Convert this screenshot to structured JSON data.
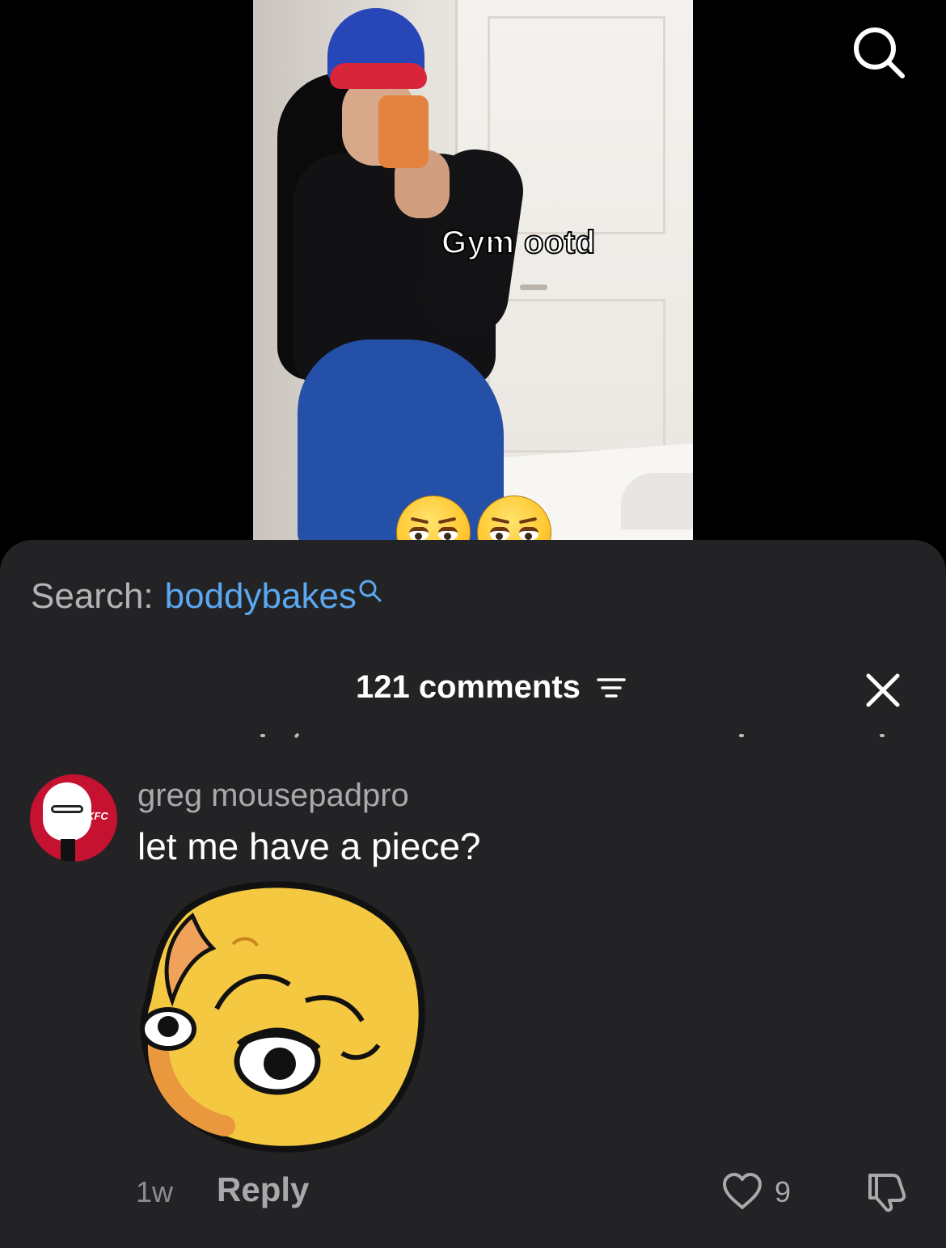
{
  "video": {
    "caption": "Gym ootd",
    "caption_emojis": [
      "😩",
      "😩"
    ]
  },
  "top_bar": {
    "search_icon": "search-icon"
  },
  "search_suggestion": {
    "prefix": "Search:",
    "term": "boddybakes",
    "icon": "search-icon"
  },
  "comments_panel": {
    "count_label": "121 comments",
    "filter_icon": "filter-icon",
    "close_icon": "close-icon",
    "comments": [
      {
        "username": "greg mousepadpro",
        "avatar_text": "KFC",
        "text": "let me have a piece?",
        "sticker": "smirking-face-sticker",
        "time": "1w",
        "reply_label": "Reply",
        "likes": "9",
        "like_icon": "heart-icon",
        "dislike_icon": "thumbs-down-icon"
      }
    ]
  },
  "colors": {
    "sheet_bg": "#232325",
    "link_blue": "#5aa8f0",
    "muted_text": "#a9a9ab"
  }
}
